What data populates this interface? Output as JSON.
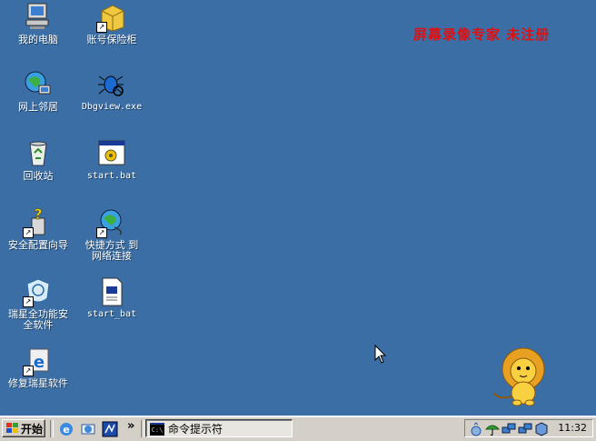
{
  "desktop": {
    "icons": [
      {
        "label": "我的电脑"
      },
      {
        "label": "账号保险柜"
      },
      {
        "label": "网上邻居"
      },
      {
        "label": "Dbgview.exe"
      },
      {
        "label": "回收站"
      },
      {
        "label": "start.bat"
      },
      {
        "label": "安全配置向导"
      },
      {
        "label": "快捷方式 到 网络连接"
      },
      {
        "label": "瑞星全功能安全软件"
      },
      {
        "label": "start_bat"
      },
      {
        "label": "修复瑞星软件"
      }
    ],
    "watermark": "屏幕录像专家  未注册"
  },
  "taskbar": {
    "start_label": "开始",
    "chevron": "»",
    "active_task": "命令提示符",
    "task_icon_text": "C:\\",
    "clock": "11:32"
  },
  "colors": {
    "desktop": "#3a6ea5",
    "taskbar": "#d4d0c8",
    "watermark": "#e01010"
  }
}
